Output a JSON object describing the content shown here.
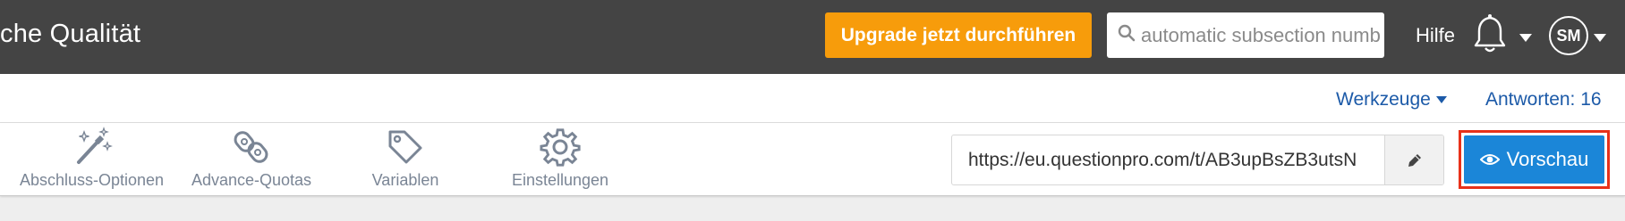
{
  "header": {
    "title": "che Qualität",
    "upgrade_label": "Upgrade jetzt durchführen",
    "search": {
      "placeholder": "automatic subsection numb"
    },
    "help_label": "Hilfe",
    "avatar_initials": "SM"
  },
  "subbar": {
    "tools_label": "Werkzeuge",
    "responses_label": "Antworten: 16"
  },
  "toolbar": {
    "items": [
      {
        "label": "Abschluss-Optionen",
        "icon": "magic-wand-icon"
      },
      {
        "label": "Advance-Quotas",
        "icon": "quota-link-icon"
      },
      {
        "label": "Variablen",
        "icon": "tag-icon"
      },
      {
        "label": "Einstellungen",
        "icon": "gear-icon"
      }
    ],
    "survey_url": "https://eu.questionpro.com/t/AB3upBsZB3utsN",
    "preview_label": "Vorschau"
  },
  "colors": {
    "header_bg": "#444444",
    "upgrade_bg": "#f79c0b",
    "link_blue": "#1c5aa8",
    "preview_bg": "#1b86d8",
    "highlight_border": "#e8311a"
  }
}
